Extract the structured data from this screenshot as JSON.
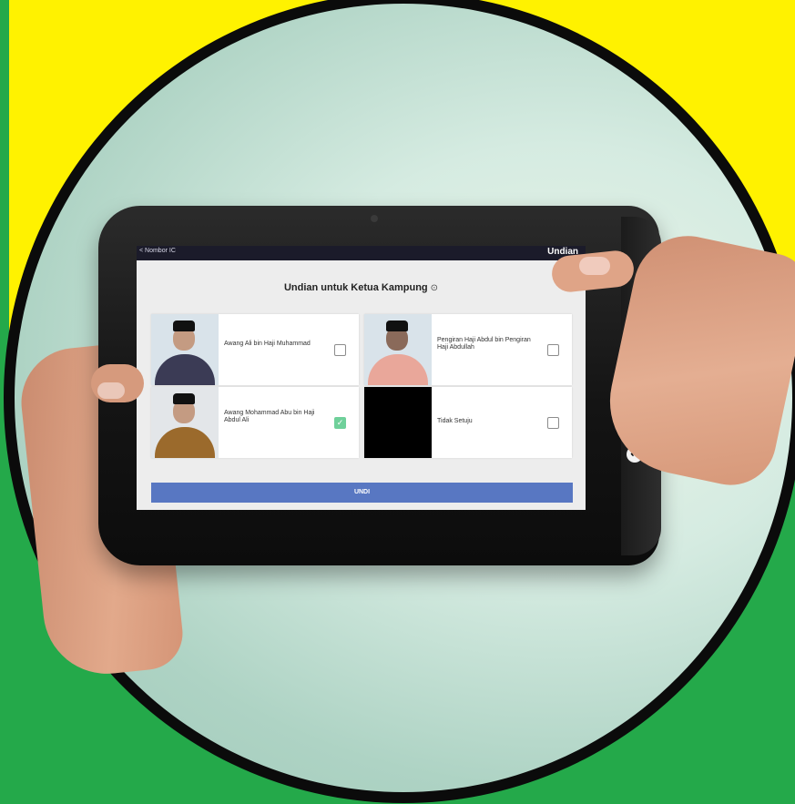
{
  "topbar": {
    "back_label": "< Nombor IC",
    "title": "Undian"
  },
  "page": {
    "title": "Undian untuk Ketua Kampung",
    "title_icon": "⊙"
  },
  "candidates": [
    {
      "name": "Awang Ali bin Haji Muhammad",
      "checked": false,
      "shirt_color": "#3b3b55"
    },
    {
      "name": "Pengiran Haji Abdul bin Pengiran Haji Abdullah",
      "checked": false,
      "shirt_color": "#e9a79a"
    },
    {
      "name": "Awang Mohammad Abu bin Haji Abdul Ali",
      "checked": true,
      "shirt_color": "#9b6a2c"
    },
    {
      "name": "Tidak Setuju",
      "checked": false,
      "shirt_color": "#000000"
    }
  ],
  "submit": {
    "label": "UNDI"
  },
  "hardware": {
    "home_icon": "home-icon",
    "back_icon": "back-icon"
  },
  "colors": {
    "accent": "#5877c2",
    "check_on": "#6fd09a",
    "yellow_bg": "#fff200",
    "green_bg": "#24a94a"
  }
}
